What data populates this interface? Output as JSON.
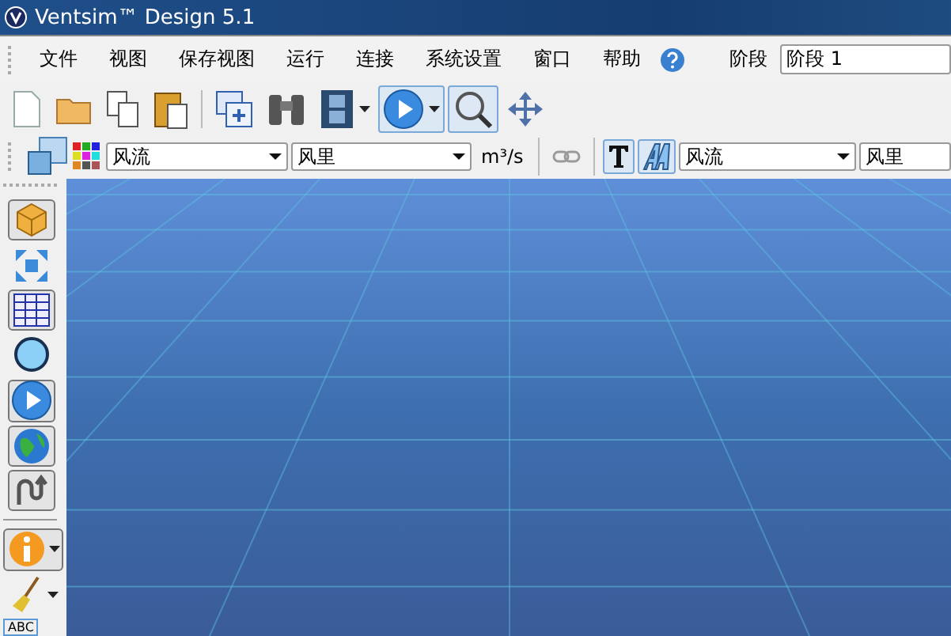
{
  "window": {
    "title": "Ventsim™ Design 5.1"
  },
  "menu": [
    {
      "label": "文件"
    },
    {
      "label": "视图"
    },
    {
      "label": "保存视图"
    },
    {
      "label": "运行"
    },
    {
      "label": "连接"
    },
    {
      "label": "系统设置"
    },
    {
      "label": "窗口"
    },
    {
      "label": "帮助"
    }
  ],
  "stage": {
    "label": "阶段",
    "value": "阶段 1"
  },
  "toolbar": [
    {
      "kind": "new",
      "pressed": false
    },
    {
      "kind": "open",
      "pressed": false
    },
    {
      "kind": "copy",
      "pressed": false
    },
    {
      "kind": "paste",
      "pressed": false
    },
    {
      "kind": "sep"
    },
    {
      "kind": "window",
      "pressed": false
    },
    {
      "kind": "binoculars",
      "pressed": false
    },
    {
      "kind": "film",
      "pressed": false,
      "menu": true
    },
    {
      "kind": "play",
      "pressed": true,
      "menu": true
    },
    {
      "kind": "zoom",
      "pressed": true
    },
    {
      "kind": "move",
      "pressed": false
    }
  ],
  "display_bar": {
    "left_fields": [
      {
        "value": "风流"
      },
      {
        "value": "风里"
      }
    ],
    "unit": "m³/s",
    "link_pressed": false,
    "text_pressed": true,
    "font_pressed": true,
    "right_fields": [
      {
        "value": "风流"
      },
      {
        "value": "风里"
      }
    ]
  },
  "sidebar": [
    {
      "kind": "cube",
      "pressed": true
    },
    {
      "kind": "expand",
      "pressed": false
    },
    {
      "kind": "table",
      "pressed": true
    },
    {
      "kind": "circle",
      "pressed": false
    },
    {
      "kind": "play",
      "pressed": true
    },
    {
      "kind": "globe",
      "pressed": true
    },
    {
      "kind": "wave",
      "pressed": true
    },
    {
      "kind": "sep"
    },
    {
      "kind": "info",
      "pressed": true,
      "menu": true
    },
    {
      "kind": "brush",
      "pressed": false,
      "menu": true
    }
  ],
  "sidebar_footer": "ABC"
}
